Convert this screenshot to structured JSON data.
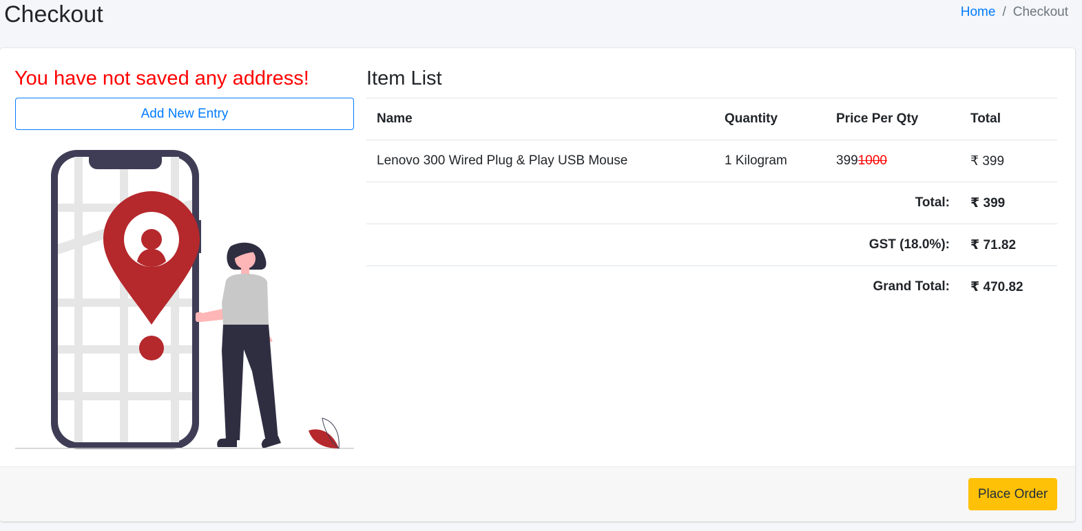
{
  "header": {
    "title": "Checkout",
    "breadcrumb": {
      "home": "Home",
      "separator": "/",
      "current": "Checkout"
    }
  },
  "address": {
    "empty_message": "You have not saved any address!",
    "add_button": "Add New Entry"
  },
  "items": {
    "title": "Item List",
    "columns": [
      "Name",
      "Quantity",
      "Price Per Qty",
      "Total"
    ],
    "rows": [
      {
        "name": "Lenovo 300 Wired Plug & Play USB Mouse",
        "quantity": "1 Kilogram",
        "price": "399",
        "old_price": "1000",
        "total": "₹ 399"
      }
    ],
    "summary": {
      "total_label": "Total:",
      "total_value": "₹ 399",
      "gst_label": "GST (18.0%):",
      "gst_value": "₹ 71.82",
      "grand_total_label": "Grand Total:",
      "grand_total_value": "₹ 470.82"
    }
  },
  "footer": {
    "place_order": "Place Order"
  },
  "colors": {
    "primary": "#007bff",
    "warning": "#ffc107",
    "danger_text": "#ff0000",
    "pin_red": "#b5282c",
    "phone_frame": "#3f3d56"
  }
}
